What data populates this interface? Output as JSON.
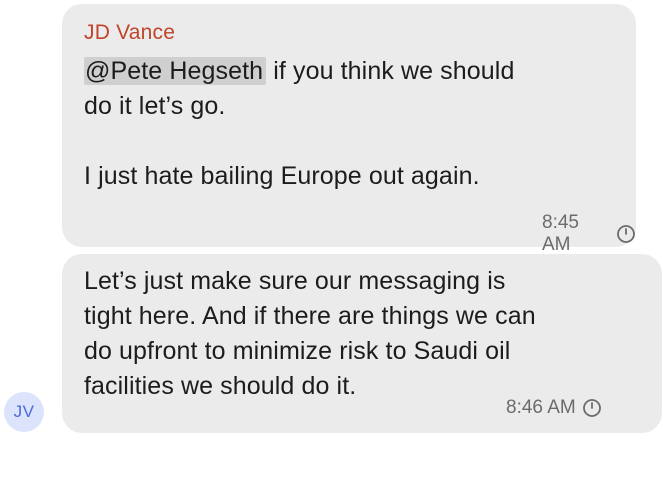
{
  "messages": [
    {
      "sender": "JD Vance",
      "mention": "@Pete Hegseth",
      "lines": [
        " if you think we should",
        "do it let’s go.",
        "",
        "I just hate bailing Europe out again."
      ],
      "time": "8:45 AM",
      "status_icon": "clock-icon"
    },
    {
      "lines": [
        "Let’s just make sure our messaging is",
        "tight here. And if there are things we can",
        "do upfront to minimize risk to Saudi oil",
        "facilities we should do it."
      ],
      "time": "8:46 AM",
      "status_icon": "clock-icon"
    }
  ],
  "avatar": {
    "initials": "JV",
    "bg_color": "#dbe4fb",
    "text_color": "#4a6bd8"
  },
  "colors": {
    "bubble": "#ebebeb",
    "sender_name": "#c0442a",
    "mention_highlight": "#cfcfcf",
    "timestamp": "#6b6b6e"
  }
}
